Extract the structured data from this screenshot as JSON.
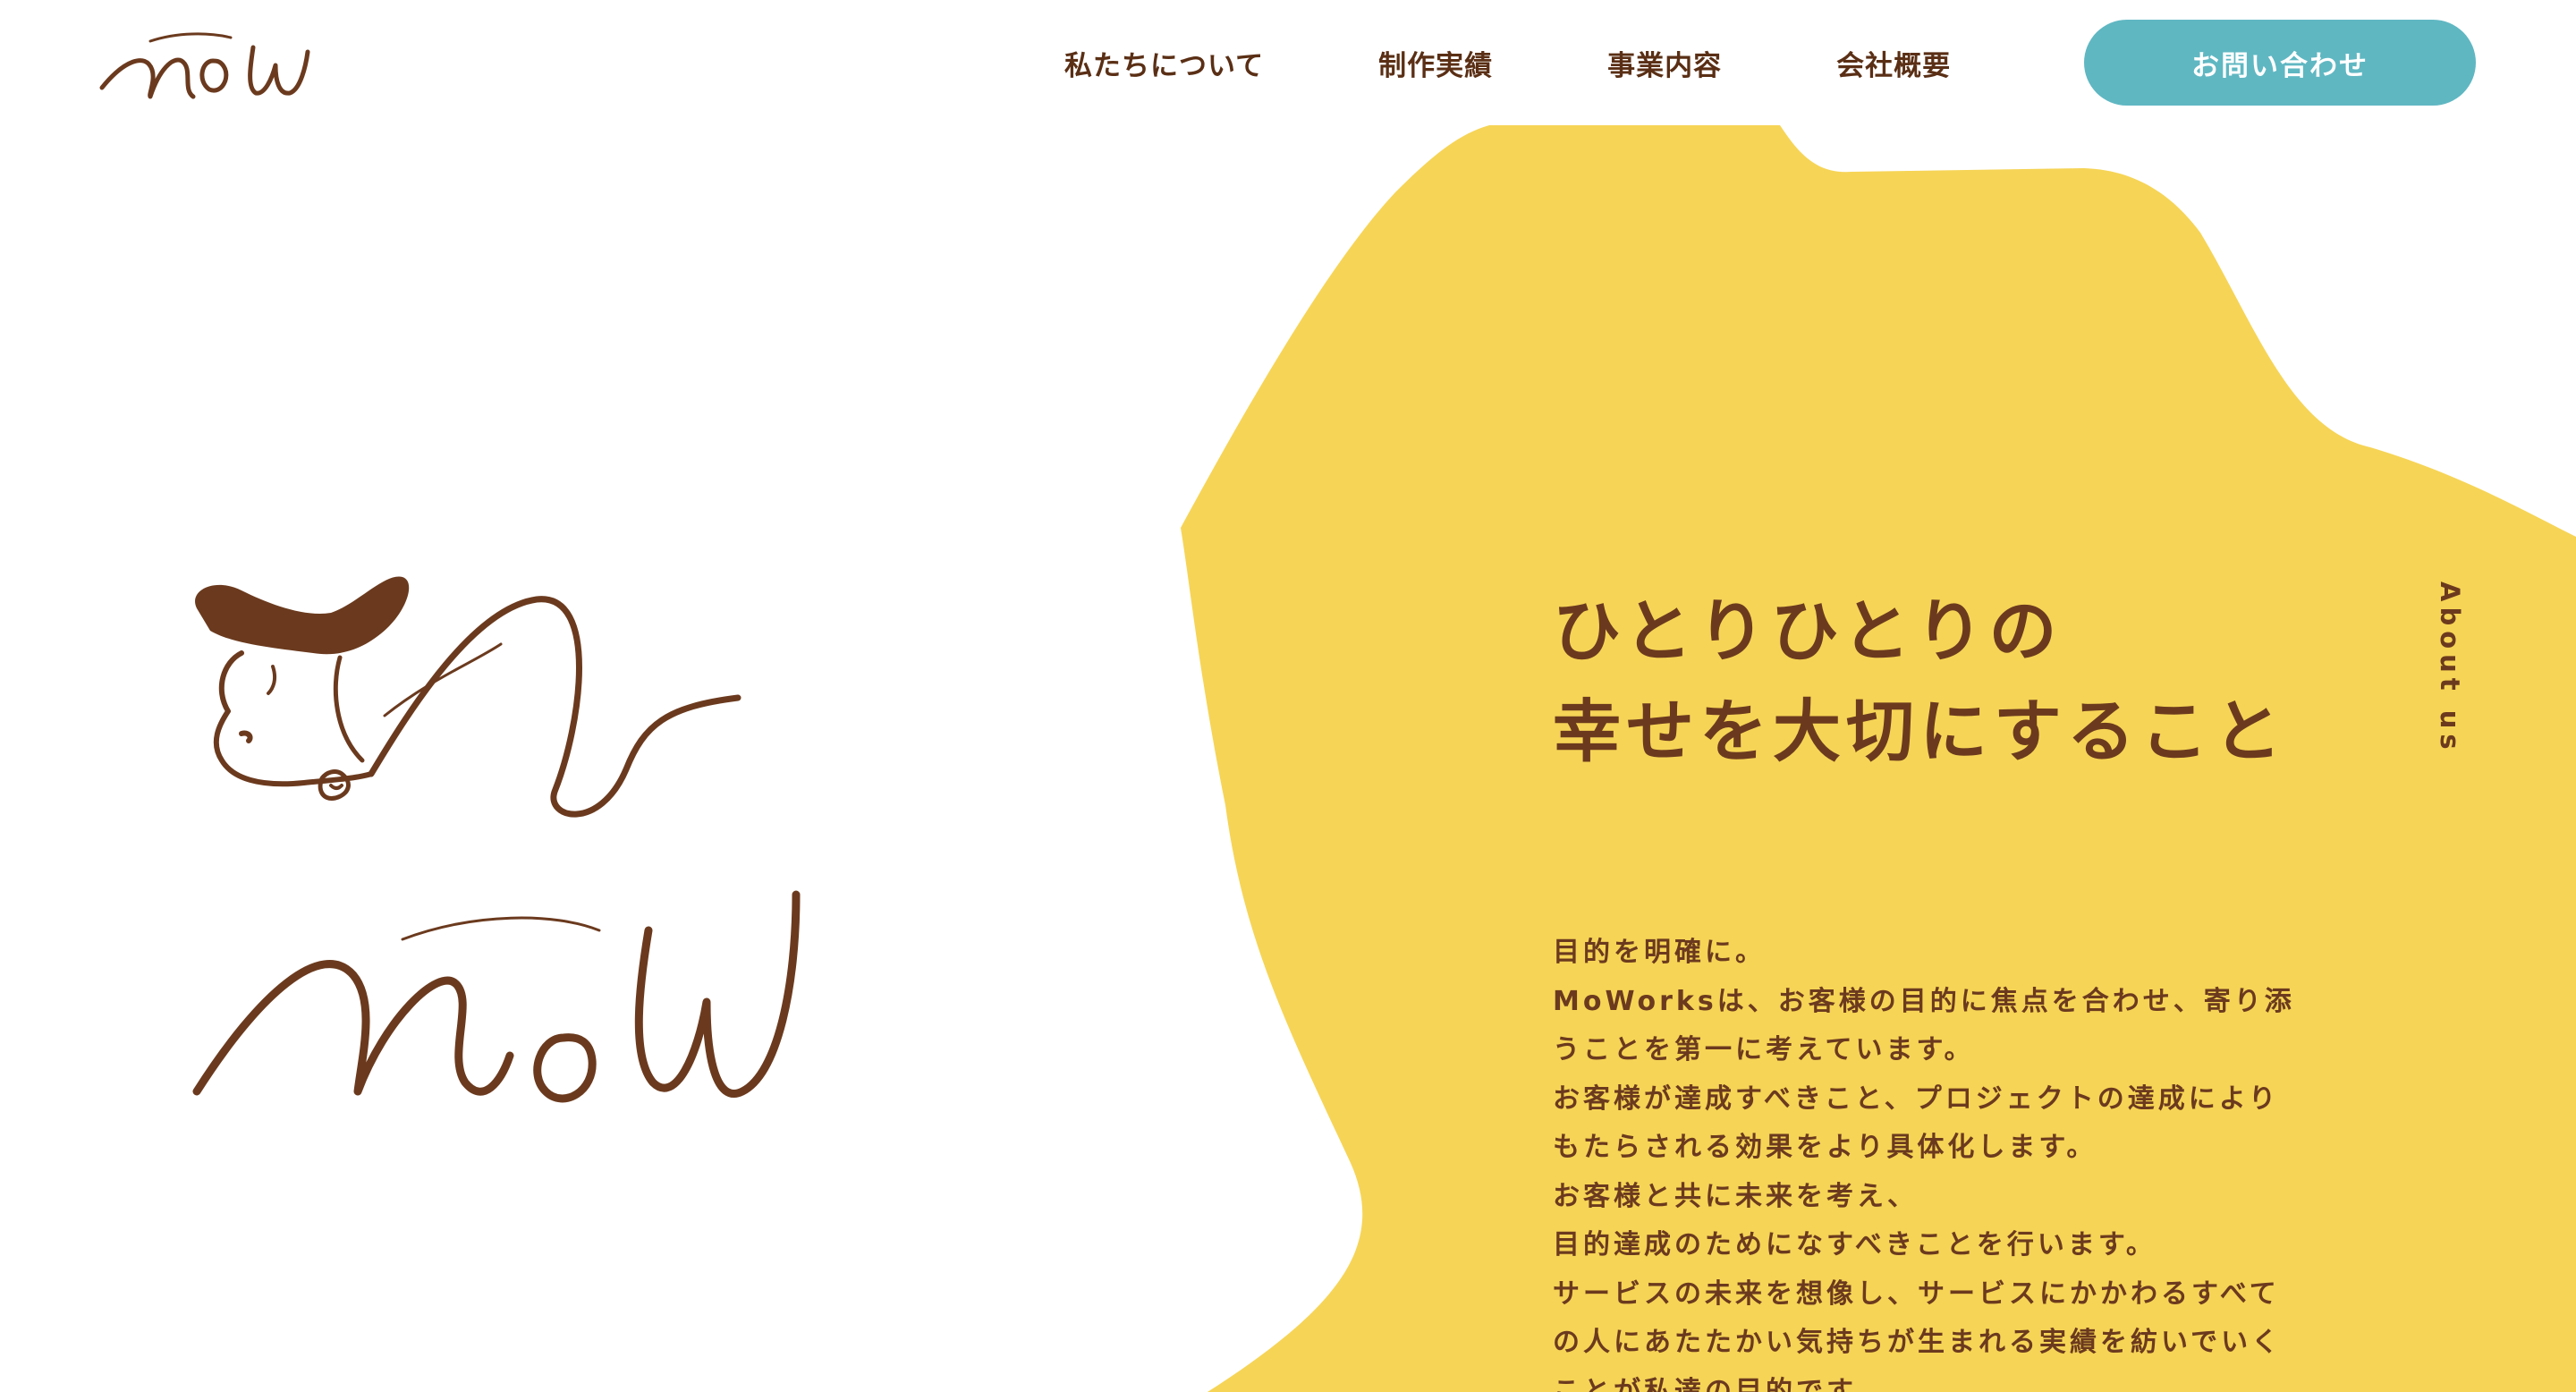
{
  "header": {
    "logo_text": "mow",
    "nav": [
      {
        "label": "私たちについて"
      },
      {
        "label": "制作実績"
      },
      {
        "label": "事業内容"
      },
      {
        "label": "会社概要"
      }
    ],
    "contact_label": "お問い合わせ"
  },
  "hero": {
    "logo_text": "mow",
    "headline": [
      "ひとりひとりの",
      "幸せを大切にすること"
    ],
    "side_label": "About us",
    "body": [
      "目的を明確に。",
      "MoWorksは、お客様の目的に焦点を合わせ、寄り添",
      "うことを第一に考えています。",
      "お客様が達成すべきこと、プロジェクトの達成により",
      "もたらされる効果をより具体化します。",
      "お客様と共に未来を考え、",
      "目的達成のためになすべきことを行います。",
      "サービスの未来を想像し、サービスにかかわるすべて",
      "の人にあたたかい気持ちが生まれる実績を紡いでいく",
      "ことが私達の目的です。"
    ]
  },
  "colors": {
    "brand_brown": "#6b3a1e",
    "accent_yellow": "#f6d456",
    "button_teal": "#5fb7c2",
    "background": "#ffffff"
  },
  "icons": {
    "logo_small": "mow-script-logo",
    "illustration": "cow-mow-illustration"
  }
}
